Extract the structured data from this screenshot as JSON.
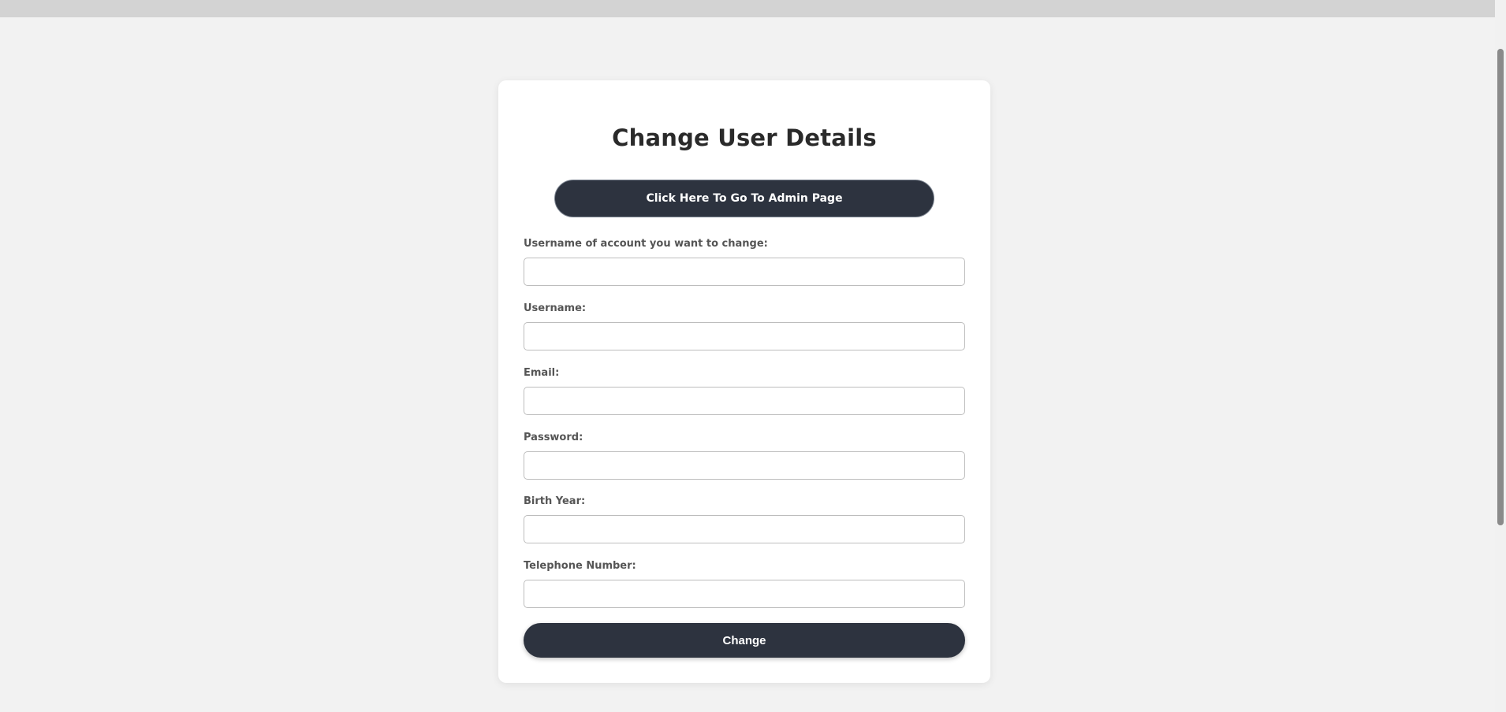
{
  "page": {
    "title": "Change User Details",
    "admin_link_label": "Click Here To Go To Admin Page"
  },
  "form": {
    "fields": [
      {
        "label": "Username of account you want to change:",
        "value": "",
        "placeholder": ""
      },
      {
        "label": "Username:",
        "value": "",
        "placeholder": ""
      },
      {
        "label": "Email:",
        "value": "",
        "placeholder": ""
      },
      {
        "label": "Password:",
        "value": "",
        "placeholder": ""
      },
      {
        "label": "Birth Year:",
        "value": "",
        "placeholder": ""
      },
      {
        "label": "Telephone Number:",
        "value": "",
        "placeholder": ""
      }
    ],
    "submit_label": "Change"
  },
  "colors": {
    "background": "#f2f2f2",
    "card": "#ffffff",
    "button": "#2d333f",
    "label": "#555555"
  }
}
